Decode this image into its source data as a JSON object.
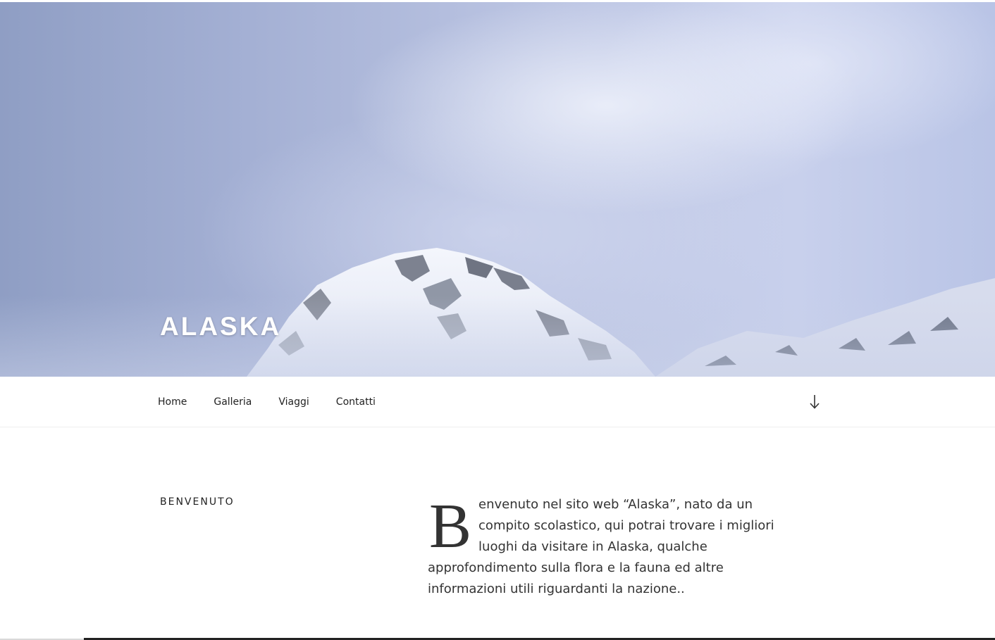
{
  "hero": {
    "site_title": "ALASKA",
    "image_alt": "snow-capped mountain peak in clouds"
  },
  "nav": {
    "items": [
      {
        "label": "Home"
      },
      {
        "label": "Galleria"
      },
      {
        "label": "Viaggi"
      },
      {
        "label": "Contatti"
      }
    ],
    "scroll_icon": "arrow-down-icon"
  },
  "content": {
    "section_title": "BENVENUTO",
    "intro_dropcap": "B",
    "intro_rest": "envenuto nel sito web “Alaska”, nato da un compito scolastico, qui potrai trovare i migliori luoghi da visitare in Alaska, qualche approfondimento sulla flora e la fauna ed altre informazioni utili riguardanti la nazione.."
  },
  "colors": {
    "sky_left": "#8f9ec4",
    "sky_right": "#c8d0ec",
    "text": "#333333",
    "nav_text": "#222222"
  }
}
